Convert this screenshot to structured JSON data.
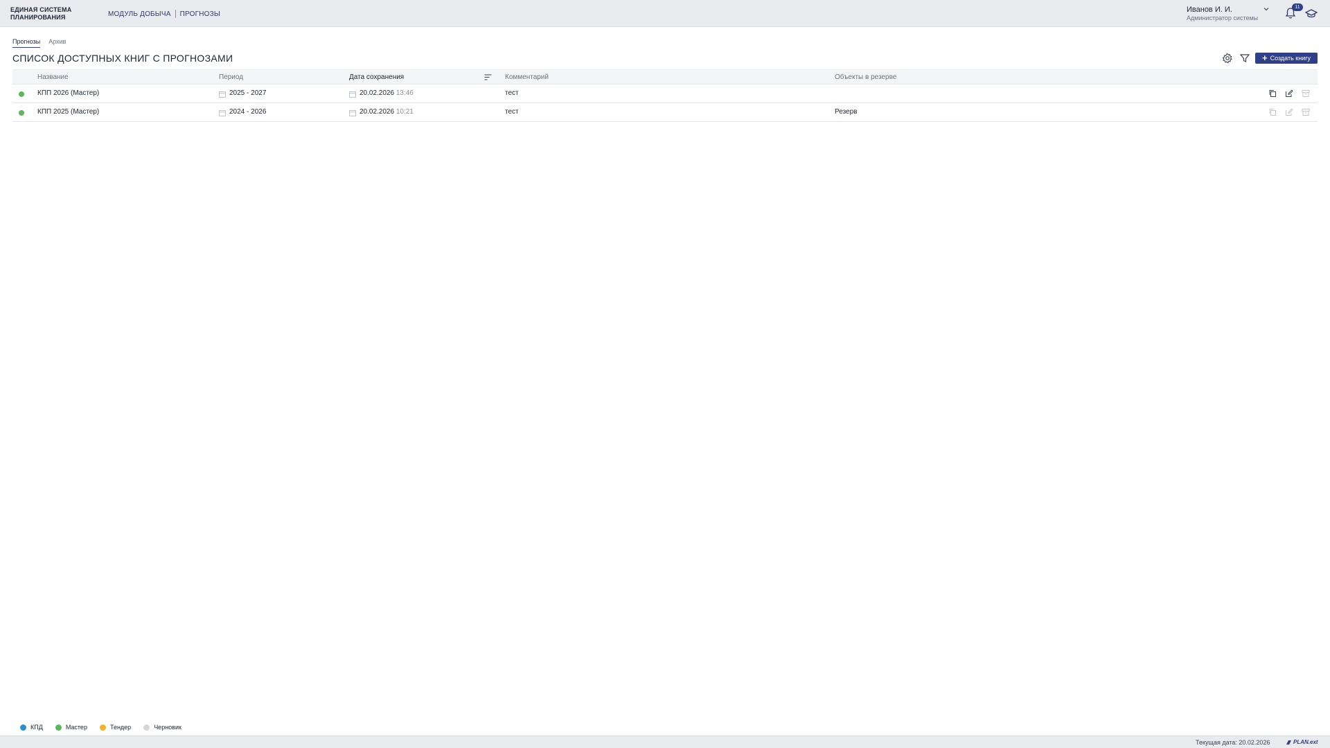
{
  "header": {
    "logo_line1": "ЕДИНАЯ СИСТЕМА",
    "logo_line2": "ПЛАНИРОВАНИЯ",
    "crumb_module": "МОДУЛЬ ДОБЫЧА",
    "crumb_section": "ПРОГНОЗЫ",
    "user_name": "Иванов И. И.",
    "user_role": "Администратор системы",
    "notifications_count": "11"
  },
  "tabs": [
    {
      "label": "Прогнозы",
      "active": true
    },
    {
      "label": "Архив",
      "active": false
    }
  ],
  "page_title": "СПИСОК ДОСТУПНЫХ КНИГ С ПРОГНОЗАМИ",
  "toolbar": {
    "create_label": "Создать книгу"
  },
  "table": {
    "columns": {
      "name": "Название",
      "period": "Период",
      "saved": "Дата сохранения",
      "comment": "Комментарий",
      "reserve": "Объекты в резерве"
    },
    "rows": [
      {
        "status_color": "#5cb85c",
        "name": "КПП 2026 (Мастер)",
        "period": "2025 - 2027",
        "date": "20.02.2026",
        "time": "13:46",
        "comment": "тест",
        "reserve": ""
      },
      {
        "status_color": "#5cb85c",
        "name": "КПП 2025 (Мастер)",
        "period": "2024 - 2026",
        "date": "20.02.2026",
        "time": "10:21",
        "comment": "тест",
        "reserve": "Резерв"
      }
    ]
  },
  "legend": [
    {
      "label": "КПД",
      "color": "#2b8fd6"
    },
    {
      "label": "Мастер",
      "color": "#5cb85c"
    },
    {
      "label": "Тендер",
      "color": "#f0b429"
    },
    {
      "label": "Черновик",
      "color": "#d4d6db"
    }
  ],
  "footer": {
    "current_date": "Текущая дата: 20.02.2026",
    "brand": "PLAN.ext"
  }
}
